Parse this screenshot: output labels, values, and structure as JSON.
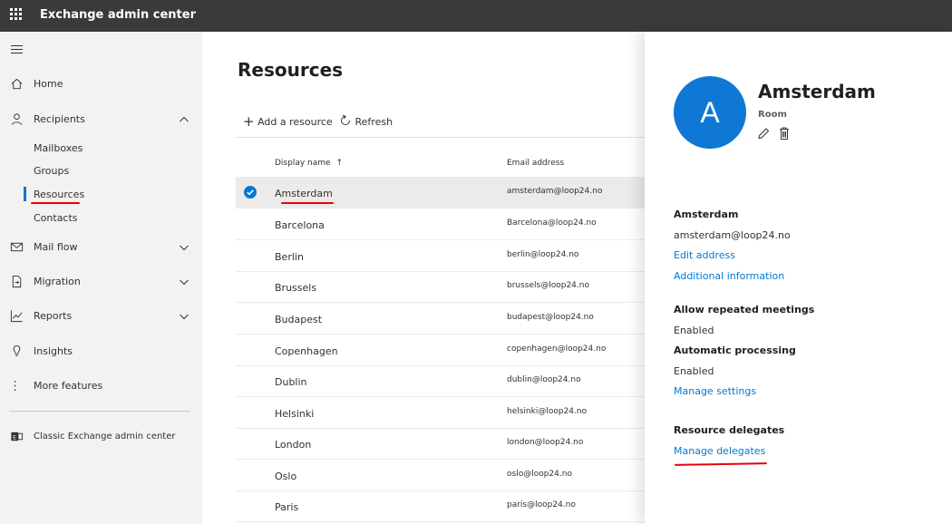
{
  "app": {
    "title": "Exchange admin center"
  },
  "sidebar": {
    "items": [
      {
        "label": "Home",
        "icon": "home-icon"
      },
      {
        "label": "Recipients",
        "icon": "person-icon"
      },
      {
        "label": "Mail flow",
        "icon": "mail-icon"
      },
      {
        "label": "Migration",
        "icon": "migration-icon"
      },
      {
        "label": "Reports",
        "icon": "chart-icon"
      },
      {
        "label": "Insights",
        "icon": "lightbulb-icon"
      },
      {
        "label": "More features",
        "icon": "more-icon"
      },
      {
        "label": "Classic Exchange admin center",
        "icon": "exchange-icon"
      }
    ],
    "recipients_children": [
      {
        "label": "Mailboxes"
      },
      {
        "label": "Groups"
      },
      {
        "label": "Resources",
        "selected": true
      },
      {
        "label": "Contacts"
      }
    ]
  },
  "main": {
    "title": "Resources",
    "commands": {
      "add_label": "Add a resource",
      "refresh_label": "Refresh"
    },
    "columns": {
      "name": "Display name",
      "email": "Email address"
    },
    "rows": [
      {
        "name": "Amsterdam",
        "email": "amsterdam@loop24.no"
      },
      {
        "name": "Barcelona",
        "email": "Barcelona@loop24.no"
      },
      {
        "name": "Berlin",
        "email": "berlin@loop24.no"
      },
      {
        "name": "Brussels",
        "email": "brussels@loop24.no"
      },
      {
        "name": "Budapest",
        "email": "budapest@loop24.no"
      },
      {
        "name": "Copenhagen",
        "email": "copenhagen@loop24.no"
      },
      {
        "name": "Dublin",
        "email": "dublin@loop24.no"
      },
      {
        "name": "Helsinki",
        "email": "helsinki@loop24.no"
      },
      {
        "name": "London",
        "email": "london@loop24.no"
      },
      {
        "name": "Oslo",
        "email": "oslo@loop24.no"
      },
      {
        "name": "Paris",
        "email": "paris@loop24.no"
      }
    ]
  },
  "panel": {
    "avatar_letter": "A",
    "title": "Amsterdam",
    "subtitle": "Room",
    "contact_heading": "Amsterdam",
    "email": "amsterdam@loop24.no",
    "edit_address": "Edit address",
    "additional_info": "Additional information",
    "repeated_heading": "Allow repeated meetings",
    "repeated_value": "Enabled",
    "processing_heading": "Automatic processing",
    "processing_value": "Enabled",
    "manage_settings": "Manage settings",
    "delegates_heading": "Resource delegates",
    "manage_delegates": "Manage delegates"
  },
  "colors": {
    "accent": "#0078d4",
    "topbar": "#3b3a39",
    "annotation": "#e3000f"
  }
}
